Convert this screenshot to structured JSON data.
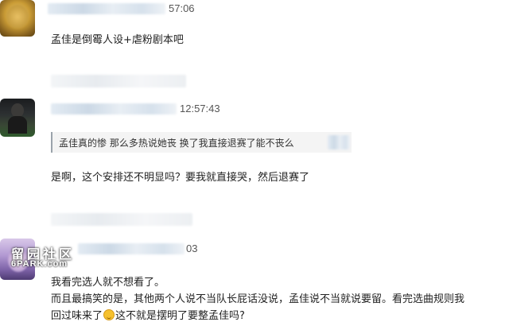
{
  "comments": [
    {
      "time": "57:06",
      "text": "孟佳是倒霉人设+虐粉剧本吧"
    },
    {
      "time": "12:57:43",
      "quote": "孟佳真的惨 那么多热说她丧 换了我直接退赛了能不丧么",
      "text": "是啊，这个安排还不明显吗？要我就直接哭，然后退赛了"
    },
    {
      "time": "03",
      "lines": [
        "我看完选人就不想看了。",
        "而且最搞笑的是，其他两个人说不当队长屁话没说，孟佳说不当就说要留。看完选曲规则我",
        "回过味来了"
      ],
      "line3_after_emoji": "这不就是摆明了要整孟佳吗?"
    }
  ],
  "watermark": {
    "cn": "留园社区",
    "en": "6PARK.com"
  },
  "colors": {
    "name_blur": "#d3dfeb",
    "quote_bar": "#9aa3ab",
    "quote_bg": "#f4f4f4"
  }
}
